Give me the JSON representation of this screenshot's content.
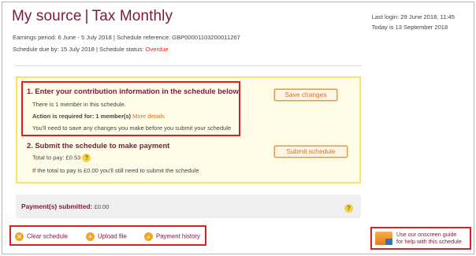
{
  "header": {
    "title_part1": "My source",
    "title_sep": "|",
    "title_part2": "Tax Monthly",
    "earnings_period_label": "Earnings period:",
    "earnings_period_value": "6 June - 5 July 2018",
    "schedule_ref_label": "Schedule reference:",
    "schedule_ref_value": "GBP00001103200011267",
    "due_label": "Schedule due by:",
    "due_value": "15 July 2018",
    "status_label": "Schedule status:",
    "status_value": "Overdue",
    "last_login": "Last login: 29 June 2018, 11:45",
    "today": "Today is 13 September 2018"
  },
  "step1": {
    "title": "1. Enter your contribution information in the schedule below",
    "members_text": "There is 1 member in this schedule.",
    "action_label": "Action is required for: 1 member(s)",
    "more_details": "More details",
    "save_note": "You'll need to save any changes you make before you submit your schedule",
    "save_button": "Save changes"
  },
  "step2": {
    "title": "2. Submit the schedule to make payment",
    "total_label": "Total to pay: £0.53",
    "zero_note": "If the total to pay is £0.00 you'll still need to submit the schedule",
    "submit_button": "Submit schedule"
  },
  "payments": {
    "label": "Payment(s) submitted:",
    "value": "£0.00"
  },
  "actions": {
    "clear": "Clear schedule",
    "upload": "Upload file",
    "history": "Payment history"
  },
  "guide": {
    "line1": "Use our onscreen guide",
    "line2": "for help with this schedule"
  },
  "colors": {
    "brand": "#7b1a3c",
    "accent": "#e0701a",
    "overdue": "#e1261c",
    "highlight": "#e02020"
  },
  "icons": {
    "help": "question-icon",
    "clear": "close-circle-icon",
    "upload": "upload-icon",
    "history": "search-icon",
    "guide": "guide-screen-icon"
  }
}
